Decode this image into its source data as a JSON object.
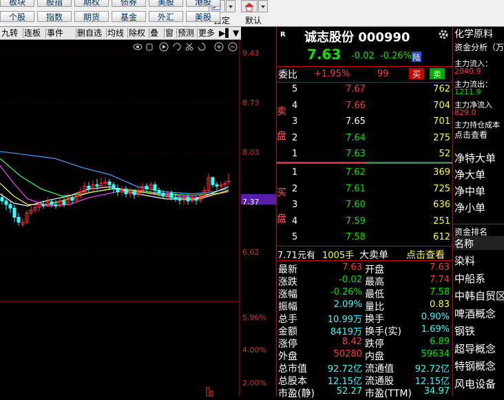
{
  "toolbar": {
    "row1": [
      "板块",
      "股指",
      "期权",
      "债券",
      "美股",
      "港股"
    ],
    "row2": [
      "个股",
      "指数",
      "期货",
      "基金",
      "外汇",
      "美股"
    ],
    "custom_label": "自定",
    "default_label": "默认"
  },
  "chart_toolbar": {
    "items": [
      "九转",
      "连板",
      "事件",
      "删自选",
      "均线",
      "除权",
      "叠",
      "窗",
      "预测",
      "更多"
    ]
  },
  "chart_data": {
    "type": "candlestick",
    "price_ticks": [
      "9.43",
      "8.73",
      "8.03",
      "7.37",
      "6.62"
    ],
    "current_price_label": "7.37",
    "volume_ticks": [
      "5.96%",
      "4.00%",
      "2.00%"
    ],
    "colors": {
      "up": "#ff3333",
      "down": "#33ffff",
      "ma_blue": "#4aa3ff",
      "ma_yellow": "#ffff33",
      "ma_magenta": "#ff44ff",
      "ma_green": "#33ff66",
      "ma_white": "#ffffff"
    }
  },
  "stock": {
    "name": "诚志股份",
    "code": "000990",
    "price": "7.63",
    "change": "-0.02",
    "change_pct": "-0.26%",
    "exchange": "陆",
    "wei_bi_label": "委比",
    "wei_bi": "+1.95%",
    "wei_cha": "99",
    "buy_btn": "买",
    "sell_btn": "卖"
  },
  "sell_side_label": [
    "卖",
    "盘"
  ],
  "buy_side_label": [
    "买",
    "盘"
  ],
  "asks": [
    {
      "level": "5",
      "price": "7.67",
      "vol": "762"
    },
    {
      "level": "4",
      "price": "7.66",
      "vol": "704"
    },
    {
      "level": "3",
      "price": "7.65",
      "vol": "701"
    },
    {
      "level": "2",
      "price": "7.64",
      "vol": "275"
    },
    {
      "level": "1",
      "price": "7.63",
      "vol": "52"
    }
  ],
  "bids": [
    {
      "level": "1",
      "price": "7.62",
      "vol": "369"
    },
    {
      "level": "2",
      "price": "7.61",
      "vol": "725"
    },
    {
      "level": "3",
      "price": "7.60",
      "vol": "636"
    },
    {
      "level": "4",
      "price": "7.59",
      "vol": "251"
    },
    {
      "level": "5",
      "price": "7.58",
      "vol": "612"
    }
  ],
  "big_order": {
    "price": "7.71",
    "unit": "元有",
    "vol": "1005手",
    "type": "大卖单",
    "link": "点击查看"
  },
  "stats": [
    {
      "l1": "最新",
      "v1": "7.63",
      "c1": "red",
      "l2": "开盘",
      "v2": "7.63",
      "c2": "red"
    },
    {
      "l1": "涨跌",
      "v1": "-0.02",
      "c1": "green",
      "l2": "最高",
      "v2": "7.74",
      "c2": "red"
    },
    {
      "l1": "涨幅",
      "v1": "-0.26%",
      "c1": "green",
      "l2": "最低",
      "v2": "7.58",
      "c2": "green"
    },
    {
      "l1": "振幅",
      "v1": "2.09%",
      "c1": "cyan",
      "l2": "量比",
      "v2": "0.83",
      "c2": "yellow"
    },
    {
      "l1": "总手",
      "v1": "10.99万",
      "c1": "cyan",
      "l2": "换手",
      "v2": "0.90%",
      "c2": "cyan"
    },
    {
      "l1": "金额",
      "v1": "8419万",
      "c1": "cyan",
      "l2": "换手(实)",
      "v2": "1.69%",
      "c2": "cyan"
    },
    {
      "l1": "涨停",
      "v1": "8.42",
      "c1": "red",
      "l2": "跌停",
      "v2": "6.89",
      "c2": "green"
    },
    {
      "l1": "外盘",
      "v1": "50280",
      "c1": "red",
      "l2": "内盘",
      "v2": "59634",
      "c2": "green"
    },
    {
      "l1": "总市值",
      "v1": "92.72亿",
      "c1": "cyan",
      "l2": "流通值",
      "v2": "92.72亿",
      "c2": "cyan"
    },
    {
      "l1": "总股本",
      "v1": "12.15亿",
      "c1": "cyan",
      "l2": "流通股",
      "v2": "12.15亿",
      "c2": "cyan"
    },
    {
      "l1": "市盈(静)",
      "v1": "52.27",
      "c1": "cyan",
      "l2": "市盈(TTM)",
      "v2": "34.97",
      "c2": "cyan"
    }
  ],
  "sidebar": {
    "sector": "化学原料",
    "fund_title": "资金分析（万",
    "main_in_label": "主力流入：",
    "main_in": "2040.9",
    "main_out_label": "主力流出：",
    "main_out": "1211.9",
    "main_net_label": "主力净流入",
    "main_net": "829.0",
    "hold_label": "主力持仓成本",
    "hold_link": "点击查看",
    "net_items": [
      "净特大单",
      "净大单",
      "净中单",
      "净小单"
    ],
    "rank_label": "资金排名",
    "name_header": "名称",
    "concepts": [
      "染料",
      "中船系",
      "中韩自贸区",
      "啤酒概念",
      "钢铁",
      "超导概念",
      "特钢概念",
      "风电设备"
    ]
  }
}
